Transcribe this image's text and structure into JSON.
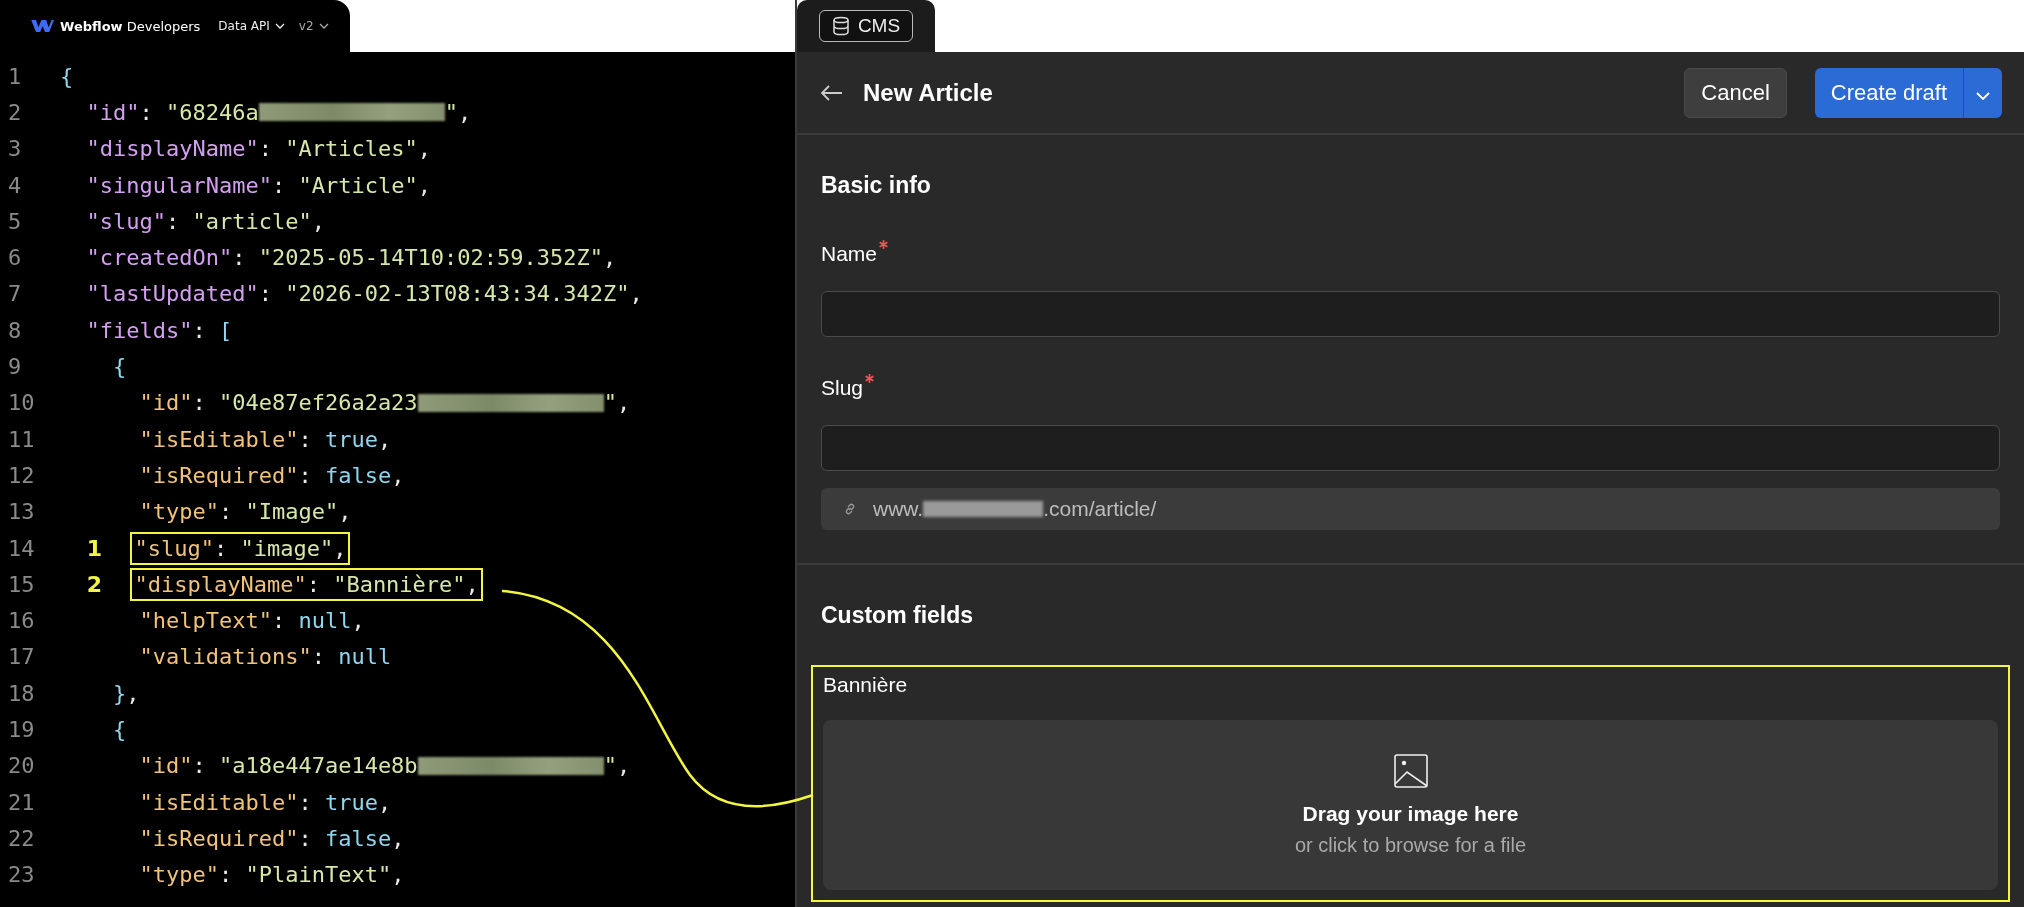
{
  "docs_header": {
    "brand": "**Webflow** Developers",
    "menus": [
      {
        "label": "Data API",
        "muted": false
      },
      {
        "label": "v2",
        "muted": true
      }
    ]
  },
  "code_lines": [
    {
      "number": "1",
      "tokens": [
        {
          "kind": "literal",
          "text": "{"
        }
      ]
    },
    {
      "number": "2",
      "tokens": [
        {
          "kind": "key",
          "text": "\"id\""
        },
        {
          "kind": "punct",
          "text": ": "
        },
        {
          "kind": "string",
          "text": "\"68246a"
        },
        {
          "kind": "redaction"
        },
        {
          "kind": "string",
          "text": "\""
        },
        {
          "kind": "punct",
          "text": ","
        }
      ]
    },
    {
      "number": "3",
      "tokens": [
        {
          "kind": "key",
          "text": "\"displayName\""
        },
        {
          "kind": "punct",
          "text": ": "
        },
        {
          "kind": "string",
          "text": "\"Articles\""
        },
        {
          "kind": "punct",
          "text": ","
        }
      ]
    },
    {
      "number": "4",
      "tokens": [
        {
          "kind": "key",
          "text": "\"singularName\""
        },
        {
          "kind": "punct",
          "text": ": "
        },
        {
          "kind": "string",
          "text": "\"Article\""
        },
        {
          "kind": "punct",
          "text": ","
        }
      ]
    },
    {
      "number": "5",
      "tokens": [
        {
          "kind": "key",
          "text": "\"slug\""
        },
        {
          "kind": "punct",
          "text": ": "
        },
        {
          "kind": "string",
          "text": "\"article\""
        },
        {
          "kind": "punct",
          "text": ","
        }
      ]
    },
    {
      "number": "6",
      "tokens": [
        {
          "kind": "key",
          "text": "\"createdOn\""
        },
        {
          "kind": "punct",
          "text": ": "
        },
        {
          "kind": "string",
          "text": "\"2025-05-14T10:02:59.352Z\""
        },
        {
          "kind": "punct",
          "text": ","
        }
      ]
    },
    {
      "number": "7",
      "tokens": [
        {
          "kind": "key",
          "text": "\"lastUpdated\""
        },
        {
          "kind": "punct",
          "text": ": "
        },
        {
          "kind": "string",
          "text": "\"2026-02-13T08:43:34.342Z\""
        },
        {
          "kind": "punct",
          "text": ","
        }
      ]
    },
    {
      "number": "8",
      "tokens": [
        {
          "kind": "key",
          "text": "\"fields\""
        },
        {
          "kind": "punct",
          "text": ": "
        },
        {
          "kind": "literal",
          "text": "["
        }
      ]
    },
    {
      "number": "9",
      "tokens": [
        {
          "kind": "literal",
          "text": "{"
        }
      ]
    },
    {
      "number": "10",
      "tokens": [
        {
          "kind": "field-key",
          "text": "\"id\""
        },
        {
          "kind": "punct",
          "text": ": "
        },
        {
          "kind": "string",
          "text": "\"04e87ef26a2a23"
        },
        {
          "kind": "redaction"
        },
        {
          "kind": "string",
          "text": "\""
        },
        {
          "kind": "punct",
          "text": ","
        }
      ]
    },
    {
      "number": "11",
      "tokens": [
        {
          "kind": "field-key",
          "text": "\"isEditable\""
        },
        {
          "kind": "punct",
          "text": ": "
        },
        {
          "kind": "literal",
          "text": "true"
        },
        {
          "kind": "punct",
          "text": ","
        }
      ]
    },
    {
      "number": "12",
      "tokens": [
        {
          "kind": "field-key",
          "text": "\"isRequired\""
        },
        {
          "kind": "punct",
          "text": ": "
        },
        {
          "kind": "literal",
          "text": "false"
        },
        {
          "kind": "punct",
          "text": ","
        }
      ]
    },
    {
      "number": "13",
      "tokens": [
        {
          "kind": "field-key",
          "text": "\"type\""
        },
        {
          "kind": "punct",
          "text": ": "
        },
        {
          "kind": "string",
          "text": "\"Image\""
        },
        {
          "kind": "punct",
          "text": ","
        }
      ]
    },
    {
      "number": "14",
      "callout": "1",
      "tokens": [
        {
          "kind": "field-key",
          "text": "\"slug\""
        },
        {
          "kind": "punct",
          "text": ": "
        },
        {
          "kind": "string",
          "text": "\"image\""
        },
        {
          "kind": "punct",
          "text": ","
        }
      ]
    },
    {
      "number": "15",
      "callout": "2",
      "tokens": [
        {
          "kind": "field-key",
          "text": "\"displayName\""
        },
        {
          "kind": "punct",
          "text": ": "
        },
        {
          "kind": "string",
          "text": "\"Bannière\""
        },
        {
          "kind": "punct",
          "text": ","
        }
      ]
    },
    {
      "number": "16",
      "tokens": [
        {
          "kind": "field-key",
          "text": "\"helpText\""
        },
        {
          "kind": "punct",
          "text": ": "
        },
        {
          "kind": "literal",
          "text": "null"
        },
        {
          "kind": "punct",
          "text": ","
        }
      ]
    },
    {
      "number": "17",
      "tokens": [
        {
          "kind": "field-key",
          "text": "\"validations\""
        },
        {
          "kind": "punct",
          "text": ": "
        },
        {
          "kind": "literal",
          "text": "null"
        }
      ]
    },
    {
      "number": "18",
      "tokens": [
        {
          "kind": "literal",
          "text": "}"
        },
        {
          "kind": "punct",
          "text": ","
        }
      ]
    },
    {
      "number": "19",
      "tokens": [
        {
          "kind": "literal",
          "text": "{"
        }
      ]
    },
    {
      "number": "20",
      "tokens": [
        {
          "kind": "field-key",
          "text": "\"id\""
        },
        {
          "kind": "punct",
          "text": ": "
        },
        {
          "kind": "string",
          "text": "\"a18e447ae14e8b"
        },
        {
          "kind": "redaction"
        },
        {
          "kind": "string",
          "text": "\""
        },
        {
          "kind": "punct",
          "text": ","
        }
      ]
    },
    {
      "number": "21",
      "tokens": [
        {
          "kind": "field-key",
          "text": "\"isEditable\""
        },
        {
          "kind": "punct",
          "text": ": "
        },
        {
          "kind": "literal",
          "text": "true"
        },
        {
          "kind": "punct",
          "text": ","
        }
      ]
    },
    {
      "number": "22",
      "tokens": [
        {
          "kind": "field-key",
          "text": "\"isRequired\""
        },
        {
          "kind": "punct",
          "text": ": "
        },
        {
          "kind": "literal",
          "text": "false"
        },
        {
          "kind": "punct",
          "text": ","
        }
      ]
    },
    {
      "number": "23",
      "tokens": [
        {
          "kind": "field-key",
          "text": "\"type\""
        },
        {
          "kind": "punct",
          "text": ": "
        },
        {
          "kind": "string",
          "text": "\"PlainText\""
        },
        {
          "kind": "punct",
          "text": ","
        }
      ]
    }
  ],
  "cms": {
    "tab": "CMS",
    "title": "New Article",
    "buttons": [
      {
        "kind": "secondary",
        "label": "Cancel"
      },
      {
        "kind": "primary",
        "label": "Create draft"
      }
    ],
    "basic_info": {
      "heading": "Basic info",
      "fields": [
        {
          "label": "Name",
          "required": true
        },
        {
          "label": "Slug",
          "required": true
        }
      ],
      "url_prefix": "www.",
      "url_suffix": ".com/article/"
    },
    "custom_fields": {
      "heading": "Custom fields",
      "fields": [
        {
          "label": "Bannière",
          "highlighted": true,
          "drop_title": "Drag your image here",
          "drop_hint": "or click to browse for a file"
        }
      ]
    }
  }
}
